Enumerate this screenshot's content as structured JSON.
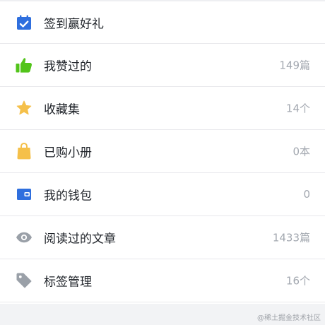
{
  "menu": {
    "items": [
      {
        "label": "签到赢好礼",
        "count": "",
        "icon": "calendar-check-icon",
        "color": "#2f6fde"
      },
      {
        "label": "我赞过的",
        "count": "149篇",
        "icon": "thumbs-up-icon",
        "color": "#52c41a"
      },
      {
        "label": "收藏集",
        "count": "14个",
        "icon": "star-icon",
        "color": "#f5c04a"
      },
      {
        "label": "已购小册",
        "count": "0本",
        "icon": "shopping-bag-icon",
        "color": "#f5c04a"
      },
      {
        "label": "我的钱包",
        "count": "0",
        "icon": "wallet-icon",
        "color": "#2f6fde"
      },
      {
        "label": "阅读过的文章",
        "count": "1433篇",
        "icon": "eye-icon",
        "color": "#9aa0a8"
      },
      {
        "label": "标签管理",
        "count": "16个",
        "icon": "tag-icon",
        "color": "#9aa0a8"
      }
    ]
  },
  "footer": {
    "watermark": "@稀土掘金技术社区"
  }
}
